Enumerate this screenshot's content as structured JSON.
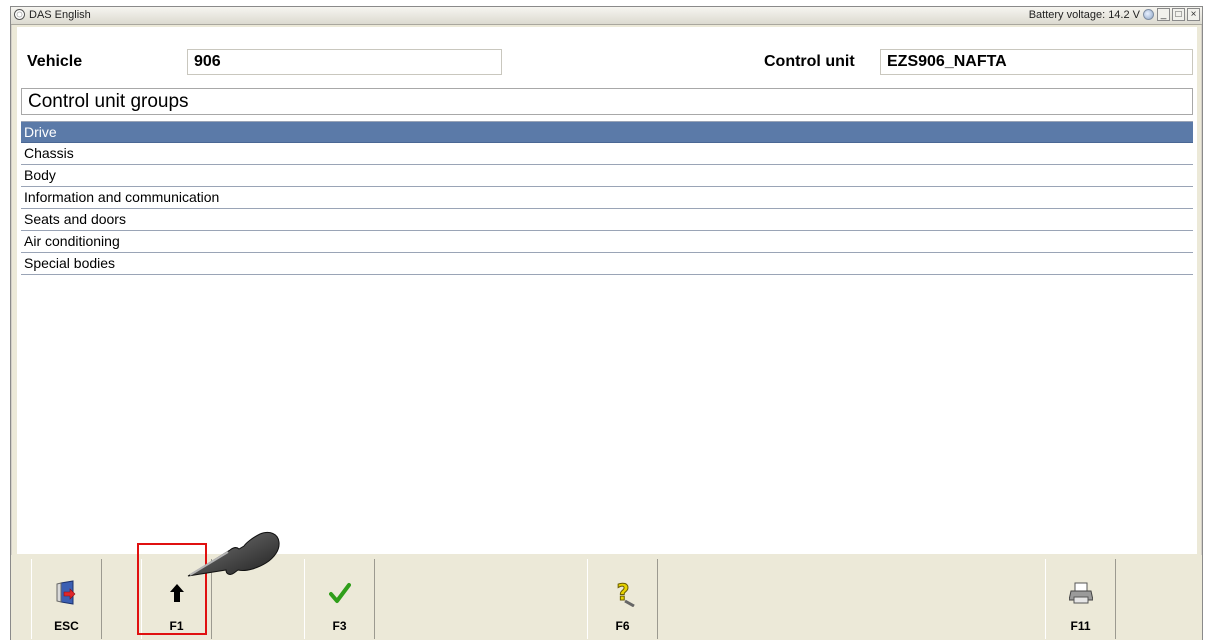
{
  "window": {
    "title": "DAS English",
    "battery_voltage": "Battery voltage: 14.2 V",
    "controls": {
      "minimize": "_",
      "restore": "□",
      "close": "×"
    }
  },
  "vehicle": {
    "label": "Vehicle",
    "value": "906"
  },
  "control_unit": {
    "label": "Control unit",
    "value": "EZS906_NAFTA"
  },
  "groups": {
    "header": "Control unit groups",
    "selected_index": 0,
    "items": [
      "Drive",
      "Chassis",
      "Body",
      "Information and communication",
      "Seats and doors",
      "Air conditioning",
      "Special bodies"
    ]
  },
  "function_keys": [
    {
      "label": "ESC",
      "icon": "exit-door-icon"
    },
    {
      "label": "F1",
      "icon": "arrow-up-icon"
    },
    {
      "label": "F3",
      "icon": "checkmark-icon"
    },
    {
      "label": "F6",
      "icon": "help-question-icon"
    },
    {
      "label": "F11",
      "icon": "printer-icon"
    }
  ],
  "colors": {
    "selection": "#5b7aa8",
    "highlight_frame": "#e01010",
    "checkmark": "#2f9e1a",
    "help": "#e6d200"
  }
}
